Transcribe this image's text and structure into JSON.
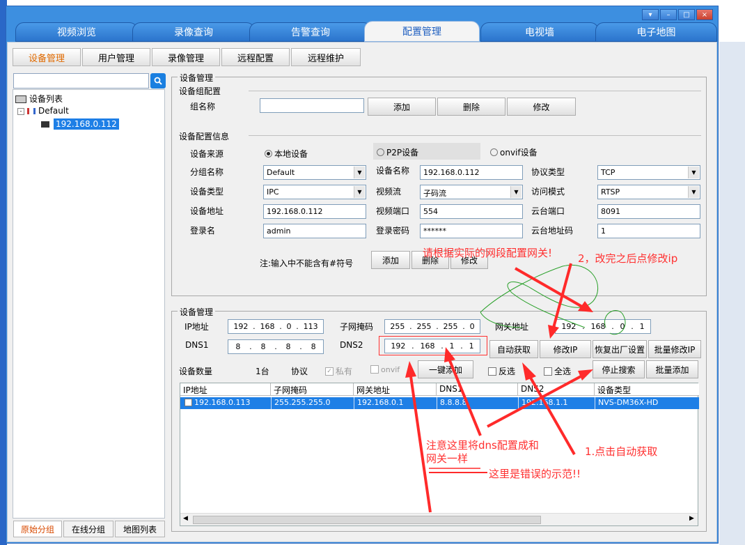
{
  "window": {
    "controls": [
      "▾",
      "–",
      "□",
      "×"
    ]
  },
  "main_tabs": [
    {
      "label": "视频浏览"
    },
    {
      "label": "录像查询"
    },
    {
      "label": "告警查询"
    },
    {
      "label": "配置管理"
    },
    {
      "label": "电视墙"
    },
    {
      "label": "电子地图"
    }
  ],
  "sub_tabs": [
    {
      "label": "设备管理"
    },
    {
      "label": "用户管理"
    },
    {
      "label": "录像管理"
    },
    {
      "label": "远程配置"
    },
    {
      "label": "远程维护"
    }
  ],
  "tree": {
    "root": "设备列表",
    "group": "Default",
    "device": "192.168.0.112"
  },
  "bottom_tabs": [
    {
      "label": "原始分组"
    },
    {
      "label": "在线分组"
    },
    {
      "label": "地图列表"
    }
  ],
  "device_mgmt": {
    "title": "设备管理",
    "group_config": {
      "title": "设备组配置",
      "name_label": "组名称",
      "name_value": "",
      "add": "添加",
      "delete": "删除",
      "modify": "修改"
    },
    "info": {
      "title": "设备配置信息",
      "source_label": "设备来源",
      "source_local": "本地设备",
      "source_p2p": "P2P设备",
      "source_onvif": "onvif设备",
      "group_name_label": "分组名称",
      "group_name_value": "Default",
      "device_name_label": "设备名称",
      "device_name_value": "192.168.0.112",
      "protocol_type_label": "协议类型",
      "protocol_type_value": "TCP",
      "device_type_label": "设备类型",
      "device_type_value": "IPC",
      "stream_label": "视频流",
      "stream_value": "子码流",
      "access_mode_label": "访问模式",
      "access_mode_value": "RTSP",
      "address_label": "设备地址",
      "address_value": "192.168.0.112",
      "video_port_label": "视频端口",
      "video_port_value": "554",
      "ptz_port_label": "云台端口",
      "ptz_port_value": "8091",
      "login_label": "登录名",
      "login_value": "admin",
      "password_label": "登录密码",
      "password_value": "******",
      "ptz_addr_label": "云台地址码",
      "ptz_addr_value": "1",
      "note": "注:输入中不能含有#符号",
      "add": "添加",
      "delete": "删除",
      "modify": "修改"
    }
  },
  "net": {
    "title": "设备管理",
    "ip_label": "IP地址",
    "ip": [
      "192",
      "168",
      "0",
      "113"
    ],
    "mask_label": "子网掩码",
    "mask": [
      "255",
      "255",
      "255",
      "0"
    ],
    "gateway_label": "网关地址",
    "gateway": [
      "192",
      "168",
      "0",
      "1"
    ],
    "dns1_label": "DNS1",
    "dns1": [
      "8",
      "8",
      "8",
      "8"
    ],
    "dns2_label": "DNS2",
    "dns2": [
      "192",
      "168",
      "1",
      "1"
    ],
    "auto_btn": "自动获取",
    "modify_ip_btn": "修改IP",
    "factory_btn": "恢复出厂设置",
    "batch_ip_btn": "批量修改IP",
    "count_label": "设备数量",
    "count_value": "1台",
    "protocol_label": "协议",
    "private_label": "私有",
    "onvif_label": "onvif",
    "one_key_btn": "一键添加",
    "invert_label": "反选",
    "select_all_label": "全选",
    "stop_search_btn": "停止搜索",
    "batch_add_btn": "批量添加"
  },
  "table": {
    "columns": [
      "IP地址",
      "子网掩码",
      "网关地址",
      "DNS1",
      "DNS2",
      "设备类型"
    ],
    "rows": [
      [
        "192.168.0.113",
        "255.255.255.0",
        "192.168.0.1",
        "8.8.8.8",
        "192.168.1.1",
        "NVS-DM36X-HD"
      ]
    ]
  },
  "annotations": {
    "gateway_note": "请根据实际的网段配置网关!",
    "step2": "2，改完之后点修改ip",
    "dns_note": "注意这里将dns配置成和网关一样",
    "wrong": "这里是错误的示范!!",
    "step1": "1.点击自动获取"
  },
  "colors": {
    "accent": "#e06a00",
    "selection": "#1e7fe6",
    "annotation": "#ff3030",
    "tab_blue": "#2b74cc"
  }
}
